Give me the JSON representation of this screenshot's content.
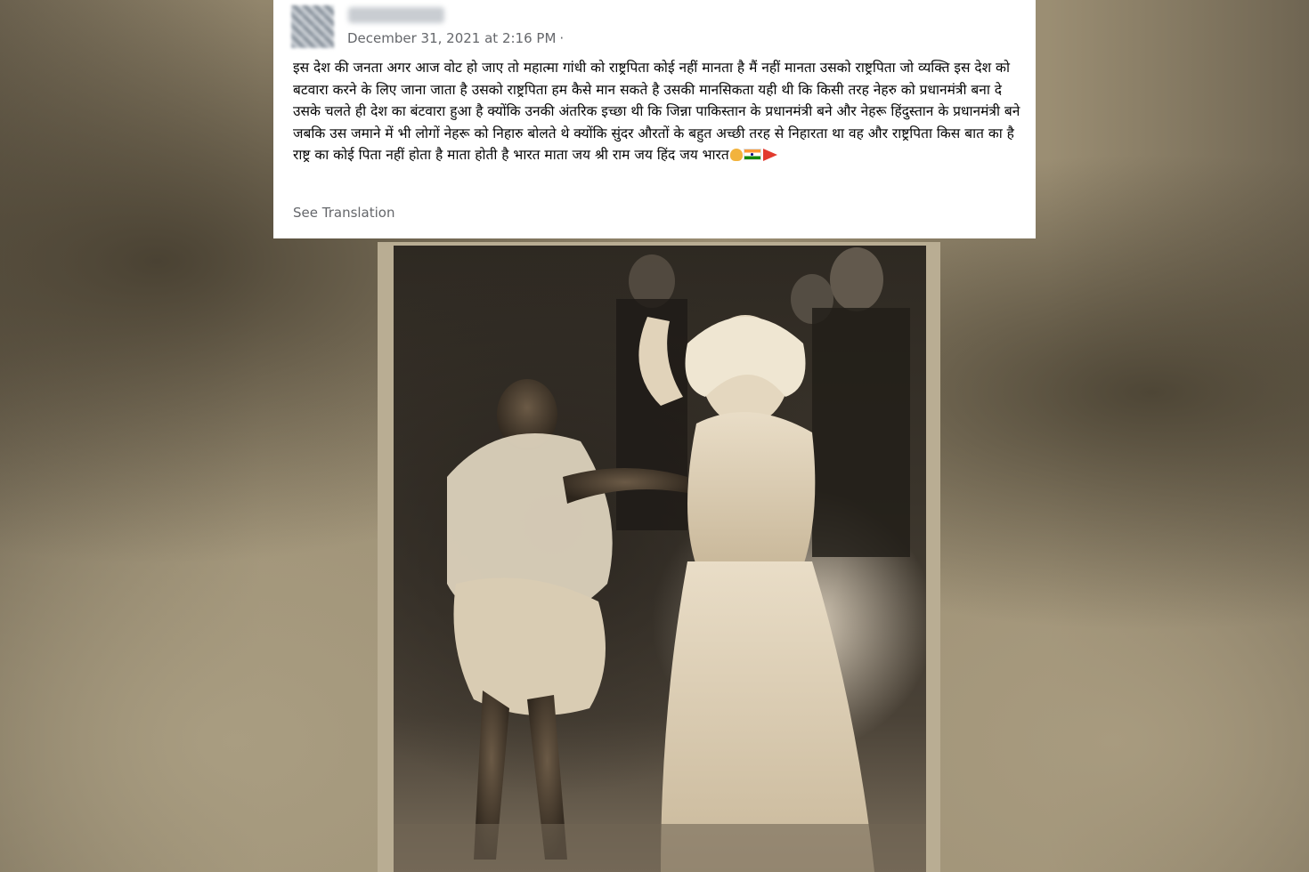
{
  "post": {
    "timestamp": "December 31, 2021 at 2:16 PM",
    "privacy_separator": "·",
    "text": "इस देश की जनता अगर आज वोट हो जाए तो महात्मा गांधी को राष्ट्रपिता कोई नहीं मानता है मैं नहीं मानता उसको राष्ट्रपिता जो व्यक्ति इस देश को बटवारा करने के लिए जाना जाता है उसको राष्ट्रपिता हम कैसे मान सकते है उसकी मानसिकता यही थी कि किसी तरह नेहरु को प्रधानमंत्री बना दे उसके चलते ही देश का बंटवारा हुआ है क्योंकि उनकी अंतरिक इच्छा  थी कि जिन्ना पाकिस्तान के प्रधानमंत्री बने और नेहरू हिंदुस्तान के प्रधानमंत्री बने जबकि उस जमाने में भी लोगों नेहरू को निहारु बोलते थे क्योंकि सुंदर औरतों के बहुत अच्छी तरह से निहारता था वह और राष्ट्रपिता किस बात का है राष्ट्र का कोई पिता नहीं होता है माता होती है भारत माता जय श्री राम जय हिंद जय भारत",
    "emojis": [
      "folded-hands-icon",
      "india-flag-icon",
      "saffron-pennant-icon"
    ],
    "see_translation": "See Translation"
  },
  "colors": {
    "card_bg": "#ffffff",
    "meta_text": "#65676b",
    "body_text": "#050505",
    "backdrop": "#8f836a",
    "photo_frame": "#b9ad93"
  }
}
